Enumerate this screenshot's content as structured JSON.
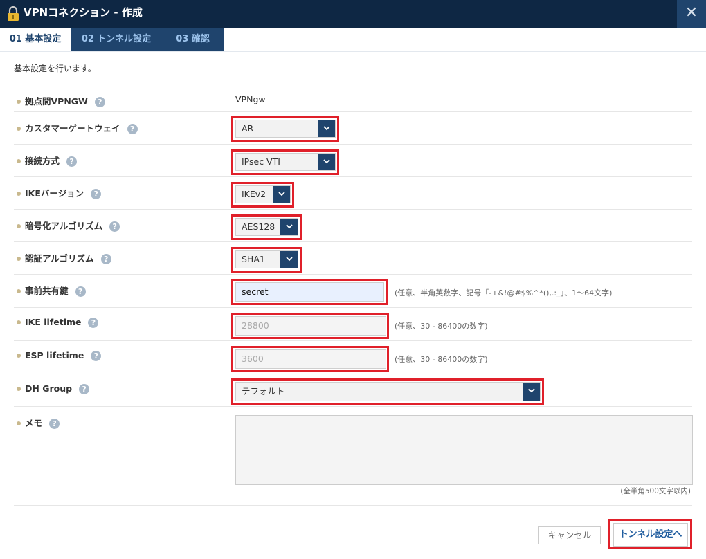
{
  "window": {
    "title": "VPNコネクション - 作成",
    "close_symbol": "✕"
  },
  "tabs": [
    {
      "label": "01 基本設定",
      "active": true
    },
    {
      "label": "02 トンネル設定",
      "active": false
    },
    {
      "label": "03 確認",
      "active": false
    }
  ],
  "intro": "基本設定を行います。",
  "help_symbol": "?",
  "fields": {
    "gateway": {
      "label": "拠点間VPNGW",
      "value": "VPNgw"
    },
    "customer_gateway": {
      "label": "カスタマーゲートウェイ",
      "value": "AR"
    },
    "connection_type": {
      "label": "接続方式",
      "value": "IPsec VTI"
    },
    "ike_version": {
      "label": "IKEバージョン",
      "value": "IKEv2"
    },
    "encryption": {
      "label": "暗号化アルゴリズム",
      "value": "AES128"
    },
    "auth": {
      "label": "認証アルゴリズム",
      "value": "SHA1"
    },
    "psk": {
      "label": "事前共有鍵",
      "value": "secret",
      "hint": "(任意、半角英数字、記号「-+&!@#$%^*(),.:_」、1〜64文字)"
    },
    "ike_lifetime": {
      "label": "IKE lifetime",
      "placeholder": "28800",
      "hint": "(任意、30 - 86400の数字)"
    },
    "esp_lifetime": {
      "label": "ESP lifetime",
      "placeholder": "3600",
      "hint": "(任意、30 - 86400の数字)"
    },
    "dh_group": {
      "label": "DH Group",
      "value": "テフォルト"
    },
    "memo": {
      "label": "メモ",
      "hint": "(全半角500文字以内)"
    }
  },
  "buttons": {
    "cancel": "キャンセル",
    "next": "トンネル設定へ"
  },
  "colors": {
    "header": "#0e2744",
    "accent": "#1f446d",
    "highlight": "#e0202a"
  }
}
